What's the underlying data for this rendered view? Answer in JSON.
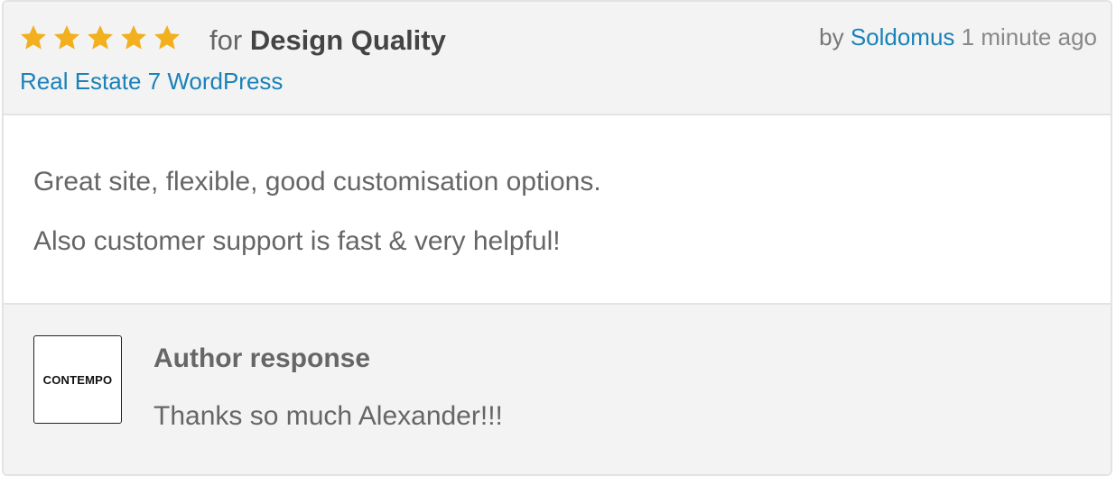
{
  "review": {
    "rating": 5,
    "rating_max": 5,
    "for_prefix": "for",
    "category": "Design Quality",
    "item_name": "Real Estate 7 WordPress",
    "by_prefix": "by",
    "author": "Soldomus",
    "time_ago": "1 minute ago",
    "lines": [
      "Great site, flexible, good customisation options.",
      "Also customer support is fast & very helpful!"
    ]
  },
  "response": {
    "title": "Author response",
    "avatar_text": "CONTEMPO",
    "text": "Thanks so much Alexander!!!"
  },
  "colors": {
    "star": "#f2b01e",
    "link": "#1a82b8",
    "header_bg": "#f3f3f3",
    "border": "#e3e3e3",
    "text": "#666666"
  },
  "icons": {
    "star": "star-icon"
  }
}
